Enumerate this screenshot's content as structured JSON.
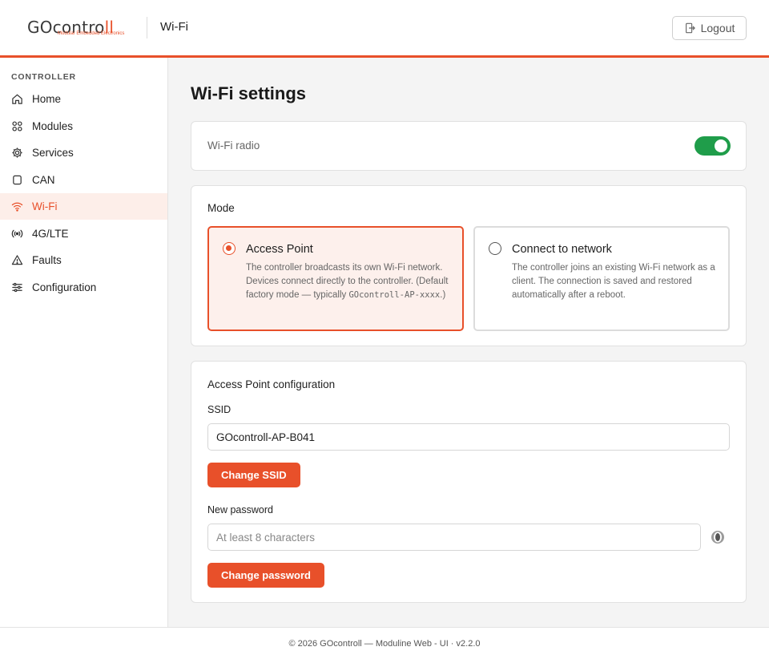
{
  "header": {
    "logo": {
      "prefix": "GO",
      "mid": "contro",
      "accent": "ll",
      "tagline": "Modular Embedded Electronics"
    },
    "title": "Wi-Fi",
    "logout_label": "Logout"
  },
  "sidebar": {
    "section": "CONTROLLER",
    "items": [
      {
        "label": "Home",
        "icon": "home-icon"
      },
      {
        "label": "Modules",
        "icon": "grid-icon"
      },
      {
        "label": "Services",
        "icon": "gear-icon"
      },
      {
        "label": "CAN",
        "icon": "chip-icon"
      },
      {
        "label": "Wi-Fi",
        "icon": "wifi-icon",
        "active": true
      },
      {
        "label": "4G/LTE",
        "icon": "signal-icon"
      },
      {
        "label": "Faults",
        "icon": "warning-icon"
      },
      {
        "label": "Configuration",
        "icon": "sliders-icon"
      }
    ]
  },
  "main": {
    "title": "Wi-Fi settings",
    "radio": {
      "label": "Wi-Fi radio",
      "enabled": true
    },
    "mode": {
      "title": "Mode",
      "selected": "Access Point",
      "options": [
        {
          "title": "Access Point",
          "desc": "The controller broadcasts its own Wi-Fi network. Devices connect directly to the controller. (Default factory mode — typically ",
          "desc_code": "GOcontroll-AP-xxxx",
          "desc_end": ".)"
        },
        {
          "title": "Connect to network",
          "desc": "The controller joins an existing Wi-Fi network as a client. The connection is saved and restored automatically after a reboot."
        }
      ]
    },
    "ap_config": {
      "title": "Access Point configuration",
      "ssid_label": "SSID",
      "ssid_value": "GOcontroll-AP-B041",
      "change_ssid": "Change SSID",
      "password_label": "New password",
      "password_placeholder": "At least 8 characters",
      "change_password": "Change password"
    }
  },
  "footer": {
    "text": "© 2026 GOcontroll — Moduline Web - UI · v2.2.0"
  },
  "colors": {
    "accent": "#e8502a",
    "toggle_on": "#1f9d4a",
    "active_bg": "#fdeee9"
  }
}
